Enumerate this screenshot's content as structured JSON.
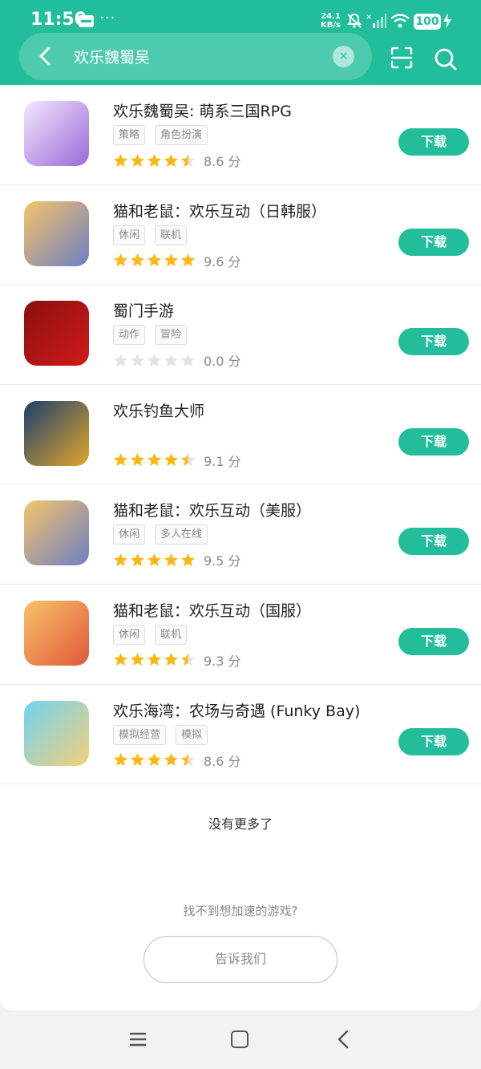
{
  "status_bar": {
    "time": "11:50",
    "speed_value": "24.1",
    "speed_unit": "KB/s",
    "battery": "100",
    "icons": [
      "mail-icon",
      "more-dots-icon",
      "mute-bell-icon",
      "signal-icon",
      "wifi-icon",
      "battery-icon",
      "charging-icon"
    ]
  },
  "search": {
    "query": "欢乐魏蜀吴",
    "clear_glyph": "×"
  },
  "results": [
    {
      "title": "欢乐魏蜀吴: 萌系三国RPG",
      "tags": [
        "策略",
        "角色扮演"
      ],
      "stars": 4.5,
      "score": "8.6 分",
      "button": "下载",
      "icon_colors": [
        "#f4e6ff",
        "#9a6ad8"
      ]
    },
    {
      "title": "猫和老鼠：欢乐互动（日韩服）",
      "tags": [
        "休闲",
        "联机"
      ],
      "stars": 5,
      "score": "9.6 分",
      "button": "下载",
      "icon_colors": [
        "#f6c46a",
        "#6c7fc4"
      ]
    },
    {
      "title": "蜀门手游",
      "tags": [
        "动作",
        "冒险"
      ],
      "stars": 0,
      "score": "0.0 分",
      "button": "下载",
      "icon_colors": [
        "#8a0f0f",
        "#d11a1a"
      ]
    },
    {
      "title": "欢乐钓鱼大师",
      "tags": [],
      "stars": 4.5,
      "score": "9.1 分",
      "button": "下载",
      "icon_colors": [
        "#1c3f6e",
        "#e2a62a"
      ]
    },
    {
      "title": "猫和老鼠：欢乐互动（美服）",
      "tags": [
        "休闲",
        "多人在线"
      ],
      "stars": 5,
      "score": "9.5 分",
      "button": "下载",
      "icon_colors": [
        "#f6c46a",
        "#6c7fc4"
      ]
    },
    {
      "title": "猫和老鼠：欢乐互动（国服）",
      "tags": [
        "休闲",
        "联机"
      ],
      "stars": 4.5,
      "score": "9.3 分",
      "button": "下载",
      "icon_colors": [
        "#f6c46a",
        "#e2563a"
      ]
    },
    {
      "title": "欢乐海湾：农场与奇遇 (Funky Bay)",
      "tags": [
        "模拟经营",
        "模拟"
      ],
      "stars": 4.5,
      "score": "8.6 分",
      "button": "下载",
      "icon_colors": [
        "#6fd3f2",
        "#f4d07a"
      ]
    }
  ],
  "footer": {
    "no_more": "没有更多了",
    "hint": "找不到想加速的游戏?",
    "tell_us": "告诉我们"
  },
  "colors": {
    "accent": "#22bd9a",
    "star": "#fbb813",
    "star_empty": "#e3e3e3"
  },
  "nav_bar": {
    "icons": [
      "menu-icon",
      "home-icon",
      "back-icon"
    ]
  }
}
